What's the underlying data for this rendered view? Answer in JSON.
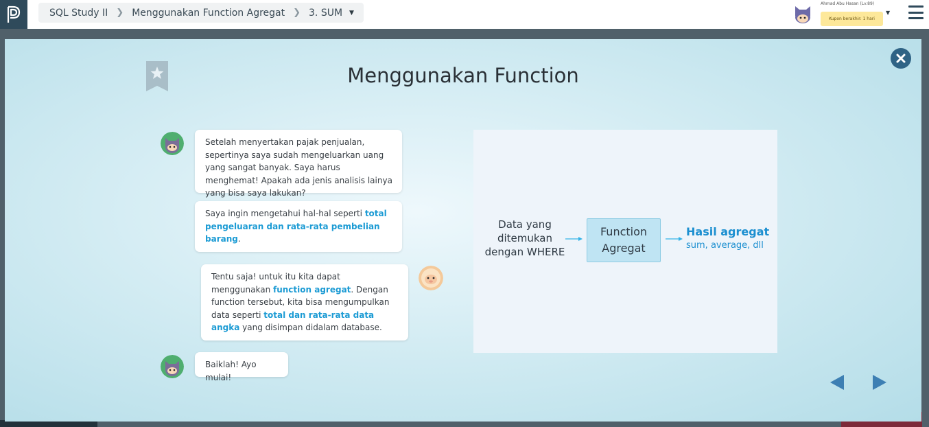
{
  "breadcrumb": {
    "course": "SQL Study II",
    "chapter": "Menggunakan Function Agregat",
    "lesson": "3. SUM"
  },
  "user": {
    "name": "Ahmad Abu Hasan (Lv.89)",
    "coupon": "Kupon berakhir: 1 hari"
  },
  "slide": {
    "title": "Menggunakan Function"
  },
  "dialogue": [
    {
      "speaker": "ninja",
      "parts": [
        "Setelah menyertakan pajak penjualan, sepertinya saya sudah mengeluarkan uang yang sangat banyak. Saya harus menghemat! Apakah ada jenis analisis lainya yang bisa saya lakukan?"
      ]
    },
    {
      "speaker": "ninja",
      "parts": [
        "Saya ingin mengetahui hal-hal seperti ",
        "total pengeluaran dan rata-rata pembelian barang",
        "."
      ]
    },
    {
      "speaker": "sheep",
      "parts": [
        "Tentu saja! untuk itu kita dapat menggunakan ",
        "function agregat",
        ". Dengan function tersebut, kita bisa mengumpulkan data seperti ",
        "total dan rata-rata data angka",
        " yang disimpan didalam database."
      ]
    },
    {
      "speaker": "ninja",
      "parts": [
        "Baiklah! Ayo mulai!"
      ]
    }
  ],
  "diagram": {
    "source": "Data yang ditemukan dengan WHERE",
    "function_box": "Function Agregat",
    "result_title": "Hasil agregat",
    "result_sub": "sum, average, dll"
  },
  "icons": {
    "logo": "progate-logo-icon",
    "bookmark": "star-bookmark-icon",
    "close": "close-icon",
    "prev": "arrow-left-icon",
    "next": "arrow-right-icon",
    "menu": "hamburger-menu-icon"
  },
  "colors": {
    "accent": "#1c9bd4",
    "close_button": "#2f6385",
    "nav_arrow": "#3d7fb3",
    "coupon_bg": "#fde89a",
    "logo_bg": "#2f4a5b"
  }
}
